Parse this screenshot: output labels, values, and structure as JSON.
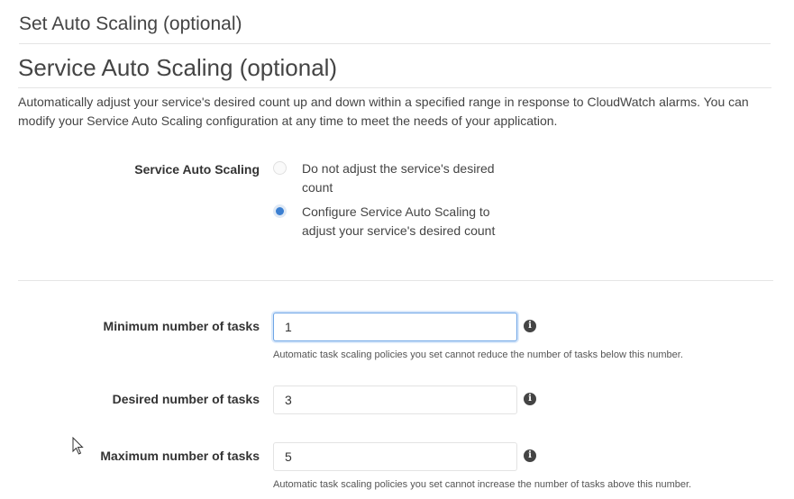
{
  "page": {
    "header": "Set Auto Scaling (optional)"
  },
  "section": {
    "title": "Service Auto Scaling (optional)",
    "description": "Automatically adjust your service's desired count up and down within a specified range in response to CloudWatch alarms. You can modify your Service Auto Scaling configuration at any time to meet the needs of your application."
  },
  "auto_scaling": {
    "label": "Service Auto Scaling",
    "options": [
      {
        "label": "Do not adjust the service's desired count",
        "selected": false
      },
      {
        "label": "Configure Service Auto Scaling to adjust your service's desired count",
        "selected": true
      }
    ]
  },
  "tasks": {
    "minimum": {
      "label": "Minimum number of tasks",
      "value": "1",
      "help": "Automatic task scaling policies you set cannot reduce the number of tasks below this number."
    },
    "desired": {
      "label": "Desired number of tasks",
      "value": "3"
    },
    "maximum": {
      "label": "Maximum number of tasks",
      "value": "5",
      "help": "Automatic task scaling policies you set cannot increase the number of tasks above this number."
    }
  },
  "icons": {
    "info": "info-icon",
    "cursor": "mouse-pointer-icon"
  },
  "colors": {
    "accent": "#3b7fd1",
    "focus_border": "#6fa6e6"
  }
}
